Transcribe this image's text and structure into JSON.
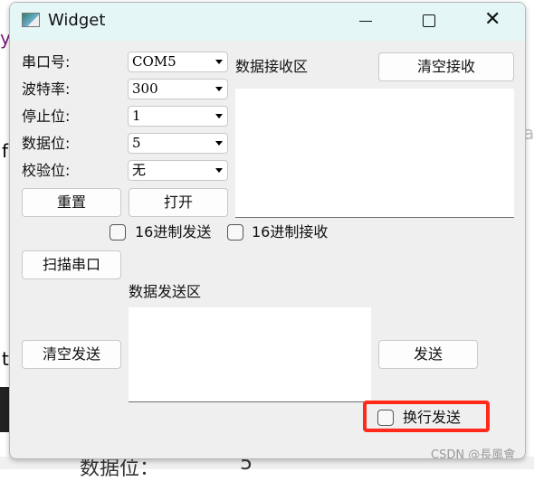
{
  "window": {
    "title": "Widget",
    "icon": "app-window-icon"
  },
  "serial": {
    "port": {
      "label": "串口号:",
      "value": "COM5"
    },
    "baud": {
      "label": "波特率:",
      "value": "300"
    },
    "stop": {
      "label": "停止位:",
      "value": "1"
    },
    "data": {
      "label": "数据位:",
      "value": "5"
    },
    "parity": {
      "label": "校验位:",
      "value": "无"
    }
  },
  "buttons": {
    "reset": "重置",
    "open": "打开",
    "scan": "扫描串口",
    "clear_recv": "清空接收",
    "clear_send": "清空发送",
    "send": "发送"
  },
  "receive": {
    "label": "数据接收区",
    "text": ""
  },
  "send_area": {
    "label": "数据发送区",
    "text": ""
  },
  "options": {
    "hex_send": {
      "label": "16进制发送",
      "checked": false
    },
    "hex_recv": {
      "label": "16进制接收",
      "checked": false
    },
    "newline_send": {
      "label": "换行发送",
      "checked": false
    }
  },
  "highlight_color": "#ff2a1a",
  "watermark": "CSDN @長風會",
  "background": {
    "frag_y": "y",
    "frag_f": "f",
    "frag_t": "t",
    "frag_a": "a",
    "bottom_label": "数据位：",
    "bottom_value": "5"
  }
}
